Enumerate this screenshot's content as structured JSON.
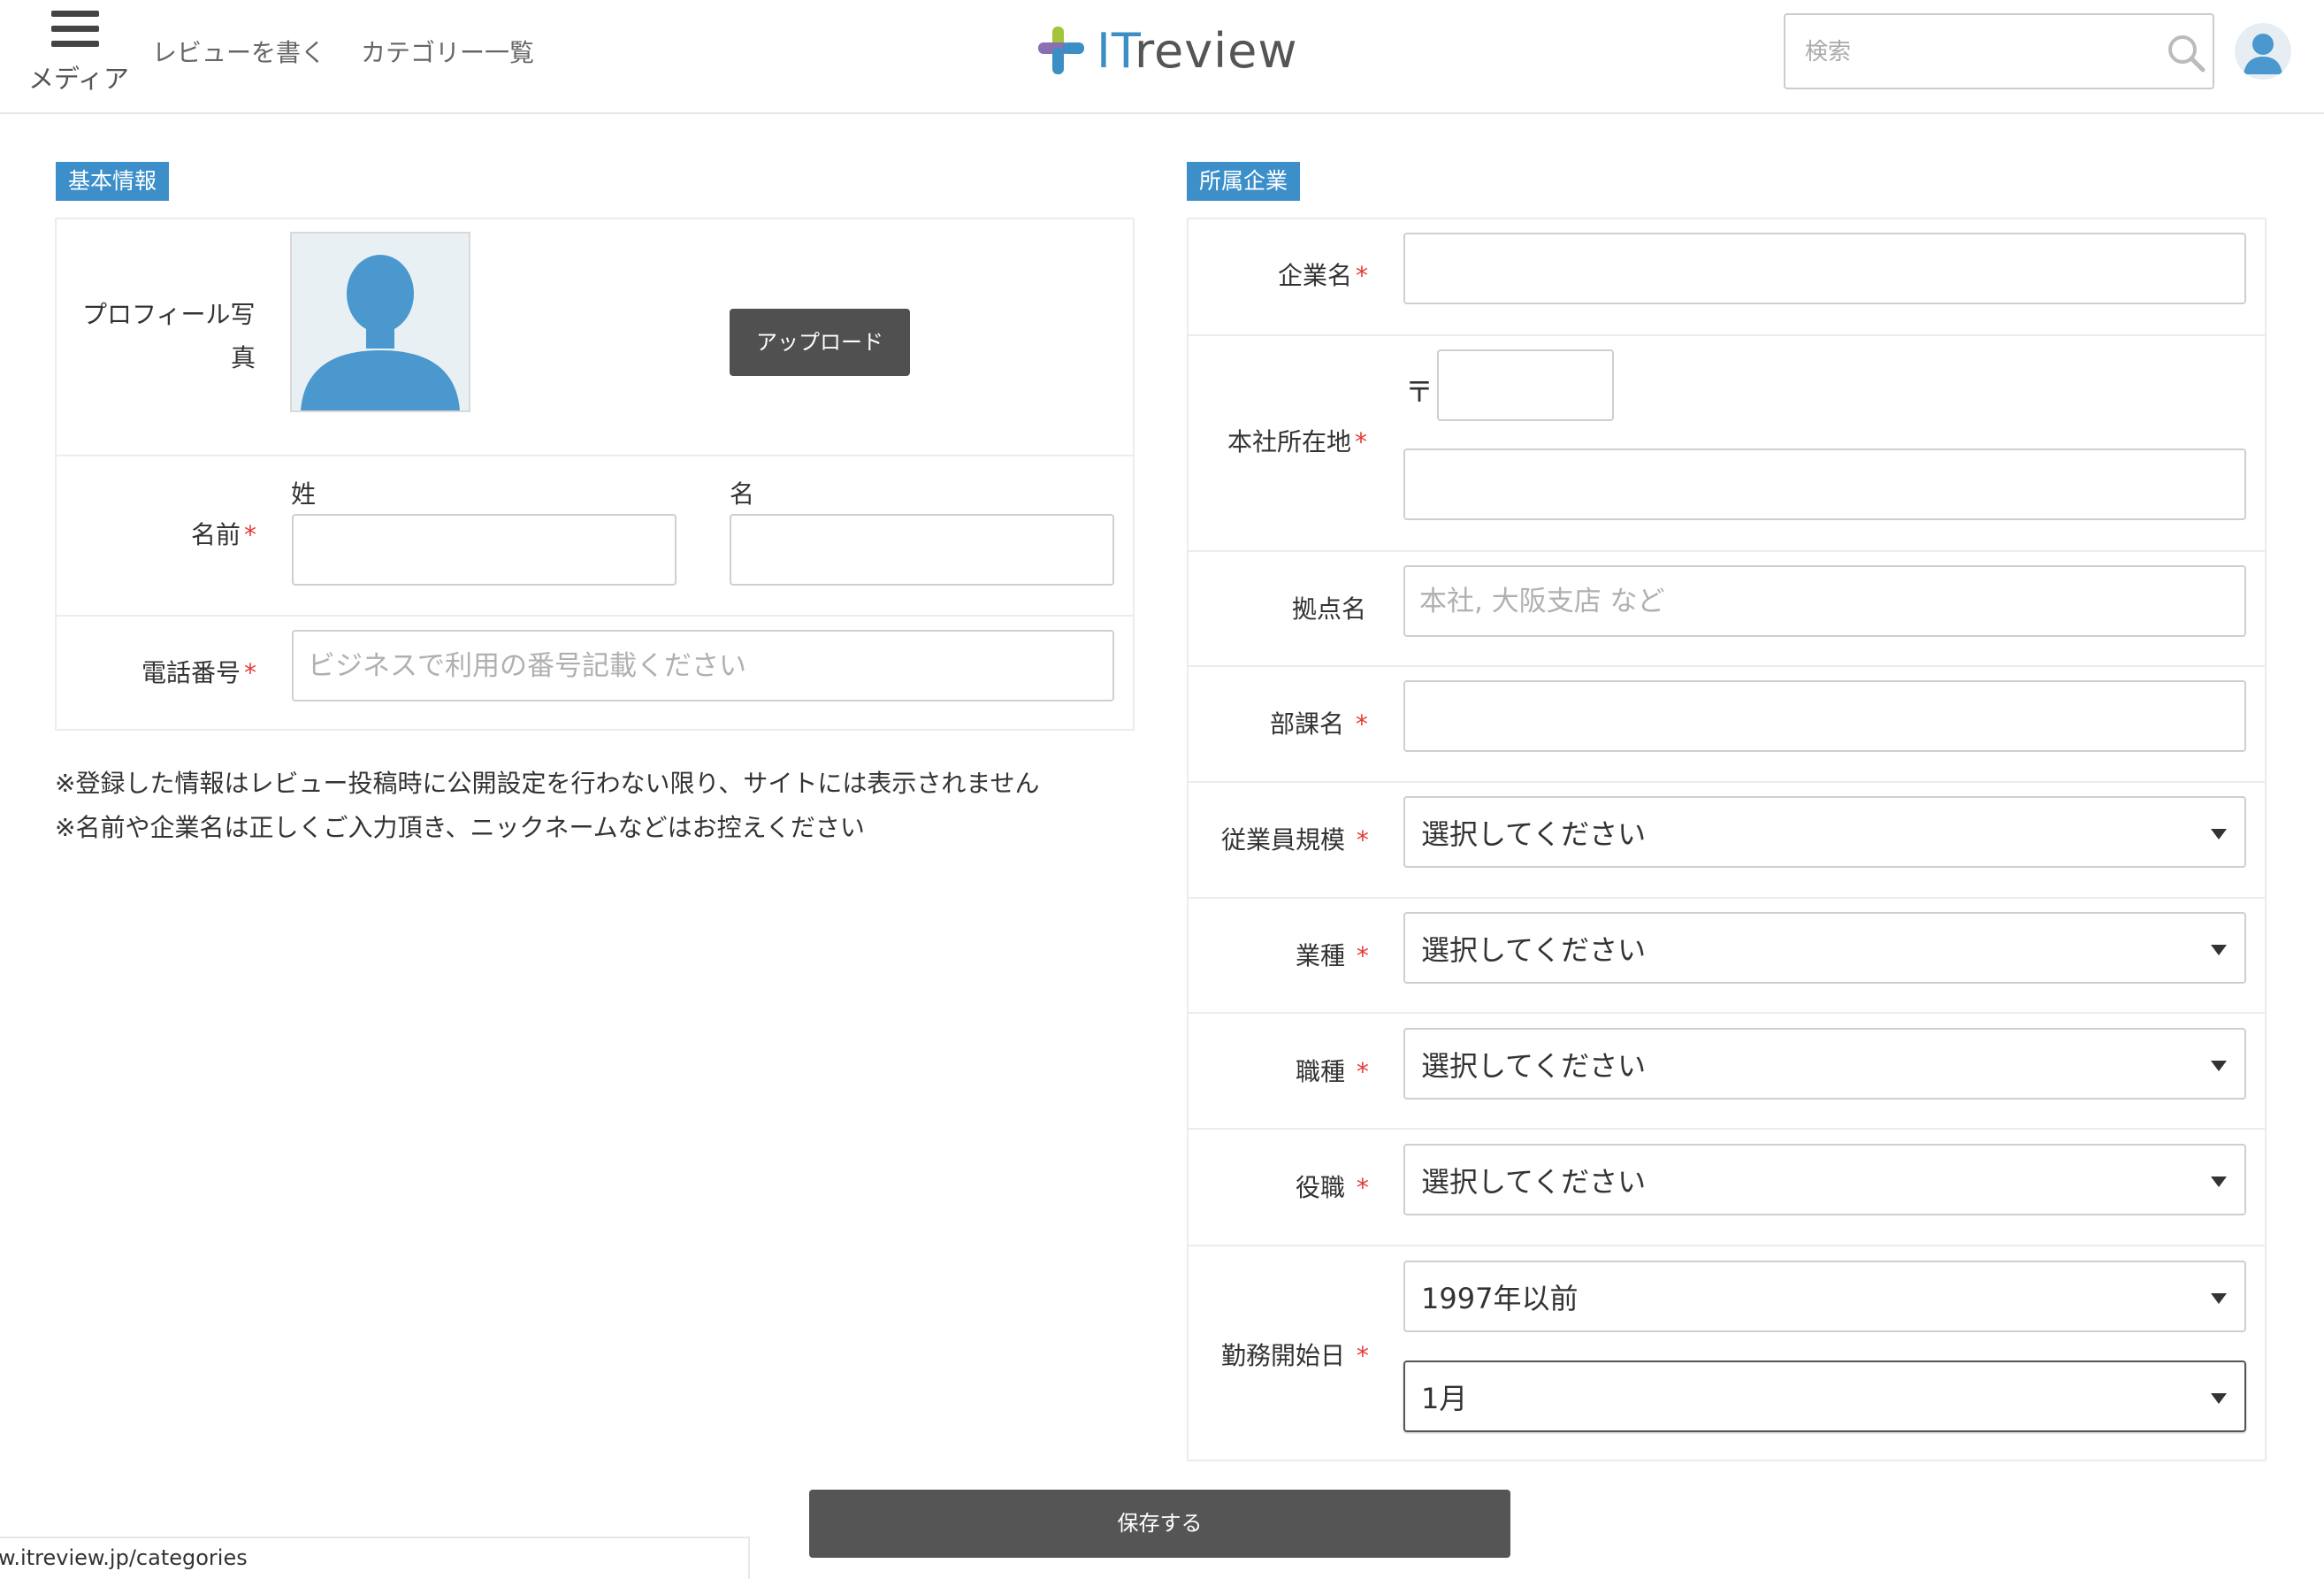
{
  "header": {
    "menu_label": "メディア",
    "nav": [
      "レビューを書く",
      "カテゴリー一覧"
    ],
    "logo_text_a": "IT",
    "logo_text_b": "review",
    "search_placeholder": "検索"
  },
  "basic_info": {
    "section_title": "基本情報",
    "photo_label_line1": "プロフィール写",
    "photo_label_line2": "真",
    "upload_button": "アップロード",
    "name_label": "名前",
    "last_name_label": "姓",
    "first_name_label": "名",
    "last_name_value": "",
    "first_name_value": "",
    "phone_label": "電話番号",
    "phone_placeholder": "ビジネスで利用の番号記載ください",
    "phone_value": ""
  },
  "required_mark": "*",
  "notes": [
    "※登録した情報はレビュー投稿時に公開設定を行わない限り、サイトには表示されません",
    "※名前や企業名は正しくご入力頂き、ニックネームなどはお控えください"
  ],
  "company": {
    "section_title": "所属企業",
    "company_name_label": "企業名",
    "company_name_value": "",
    "hq_address_label": "本社所在地",
    "postal_mark": "〒",
    "postal_value": "",
    "address_value": "",
    "branch_label": "拠点名",
    "branch_placeholder": "本社, 大阪支店 など",
    "branch_value": "",
    "department_label": "部課名",
    "department_value": "",
    "employee_size_label": "従業員規模",
    "employee_size_value": "選択してください",
    "industry_label": "業種",
    "industry_value": "選択してください",
    "job_type_label": "職種",
    "job_type_value": "選択してください",
    "position_label": "役職",
    "position_value": "選択してください",
    "start_date_label": "勤務開始日",
    "start_year_value": "1997年以前",
    "start_month_value": "1月"
  },
  "save_button": "保存する",
  "status_bar_url": "w.itreview.jp/categories",
  "colors": {
    "accent": "#3d8fca",
    "required": "#e53935",
    "button_dark": "#505050",
    "logo_green": "#a3c43b",
    "logo_purple": "#8a6fb3",
    "logo_blue": "#3b8fc5"
  }
}
